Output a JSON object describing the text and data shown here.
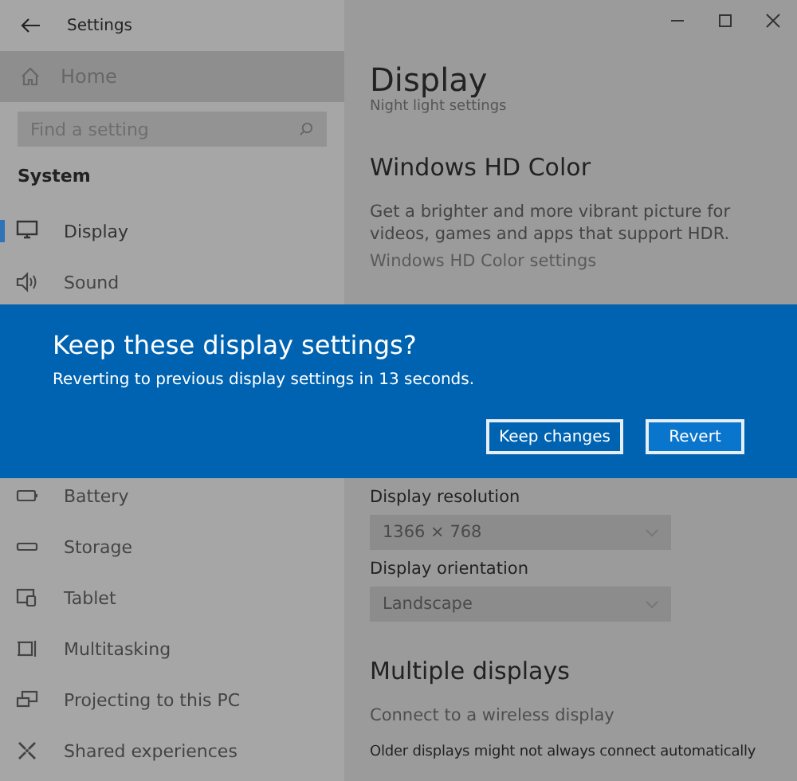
{
  "window": {
    "title": "Settings"
  },
  "sidebar": {
    "home": "Home",
    "search": {
      "placeholder": "Find a setting"
    },
    "section": "System",
    "items": [
      {
        "label": "Display",
        "kind": "monitor",
        "selected": true
      },
      {
        "label": "Sound",
        "kind": "speaker",
        "selected": false
      },
      {
        "label": "Battery",
        "kind": "battery",
        "selected": false
      },
      {
        "label": "Storage",
        "kind": "storage",
        "selected": false
      },
      {
        "label": "Tablet",
        "kind": "tablet",
        "selected": false
      },
      {
        "label": "Multitasking",
        "kind": "multitask",
        "selected": false
      },
      {
        "label": "Projecting to this PC",
        "kind": "project",
        "selected": false
      },
      {
        "label": "Shared experiences",
        "kind": "shared",
        "selected": false
      }
    ]
  },
  "content": {
    "title": "Display",
    "night_light_link": "Night light settings",
    "hd_color": {
      "heading": "Windows HD Color",
      "description": "Get a brighter and more vibrant picture for videos, games and apps that support HDR.",
      "link": "Windows HD Color settings"
    },
    "resolution": {
      "label": "Display resolution",
      "value": "1366 × 768"
    },
    "orientation": {
      "label": "Display orientation",
      "value": "Landscape"
    },
    "multiple_displays": {
      "heading": "Multiple displays",
      "link": "Connect to a wireless display",
      "note": "Older displays might not always connect automatically"
    }
  },
  "dialog": {
    "title": "Keep these display settings?",
    "message": "Reverting to previous display settings in 13 seconds.",
    "buttons": [
      {
        "label": "Keep changes",
        "kind": "secondary"
      },
      {
        "label": "Revert",
        "kind": "primary"
      }
    ]
  }
}
